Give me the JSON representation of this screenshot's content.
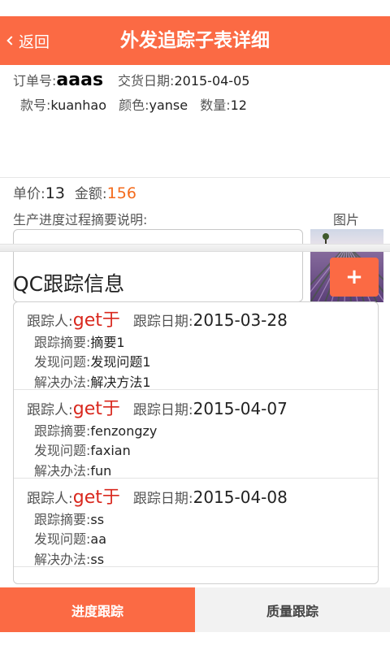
{
  "header": {
    "back_label": "返回",
    "title": "外发追踪子表详细"
  },
  "order": {
    "order_no_label": "订单号:",
    "order_no": "aaas",
    "delivery_date_label": "交货日期:",
    "delivery_date": "2015-04-05",
    "style_label": "款号:",
    "style": "kuanhao",
    "color_label": "颜色:",
    "color": "yanse",
    "qty_label": "数量:",
    "qty": "12",
    "price_label": "单价:",
    "price": "13",
    "amount_label": "金额:",
    "amount": "156",
    "progress_label": "生产进度过程摘要说明:",
    "progress_value": "",
    "picture_label": "图片"
  },
  "qc": {
    "title": "QC跟踪信息",
    "add_label": "+",
    "tracker_label": "跟踪人:",
    "date_label": "跟踪日期:",
    "summary_label": "跟踪摘要:",
    "issue_label": "发现问题:",
    "solution_label": "解决办法:",
    "items": [
      {
        "tracker": "get于",
        "date": "2015-03-28",
        "summary": "摘要1",
        "issue": "发现问题1",
        "solution": "解决方法1"
      },
      {
        "tracker": "get于",
        "date": "2015-04-07",
        "summary": "fenzongzy",
        "issue": "faxian",
        "solution": "fun"
      },
      {
        "tracker": "get于",
        "date": "2015-04-08",
        "summary": "ss",
        "issue": "aa",
        "solution": "ss"
      }
    ]
  },
  "tabs": [
    {
      "label": "进度跟踪",
      "active": true
    },
    {
      "label": "质量跟踪",
      "active": false
    }
  ],
  "colors": {
    "accent": "#fb6a44",
    "amount": "#f46b1c",
    "tracker": "#d9281e"
  }
}
